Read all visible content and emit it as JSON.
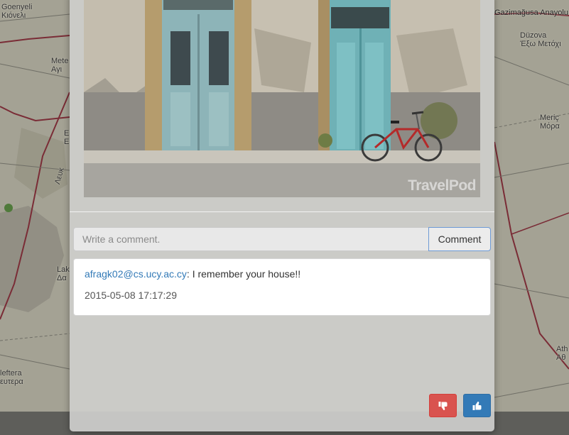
{
  "map": {
    "labels": [
      {
        "id": "goenyeli",
        "text": "Goenyeli\nΚιόνελι"
      },
      {
        "id": "gazimagusa",
        "text": "Gazimağusa Anayolu"
      },
      {
        "id": "duzova",
        "text": "Düzova\nΈξω Μετόχι"
      },
      {
        "id": "metehan",
        "text": "Mete\nΑγι"
      },
      {
        "id": "meric",
        "text": "Meriç\nΜόρα"
      },
      {
        "id": "larnaca",
        "text": "Lak\nΔα"
      },
      {
        "id": "athienou",
        "text": "Ath\nΑθ"
      },
      {
        "id": "leftera",
        "text": "leftera\nευτερα"
      },
      {
        "id": "road",
        "text": "Λευκ"
      },
      {
        "id": "e",
        "text": "E\nE"
      }
    ]
  },
  "photo": {
    "watermark": "TravelPod",
    "alt": "old doors with bicycle"
  },
  "comment_form": {
    "placeholder": "Write a comment.",
    "button_label": "Comment"
  },
  "comments": [
    {
      "author": "afragk02@cs.ucy.ac.cy",
      "separator": ": ",
      "text": "I remember your house!!",
      "date": "2015-05-08 17:17:29"
    }
  ],
  "icons": {
    "dislike": "thumbs-down-icon",
    "like": "thumbs-up-icon"
  },
  "colors": {
    "dislike": "#d9534f",
    "like": "#337ab7",
    "link": "#337ab7"
  }
}
